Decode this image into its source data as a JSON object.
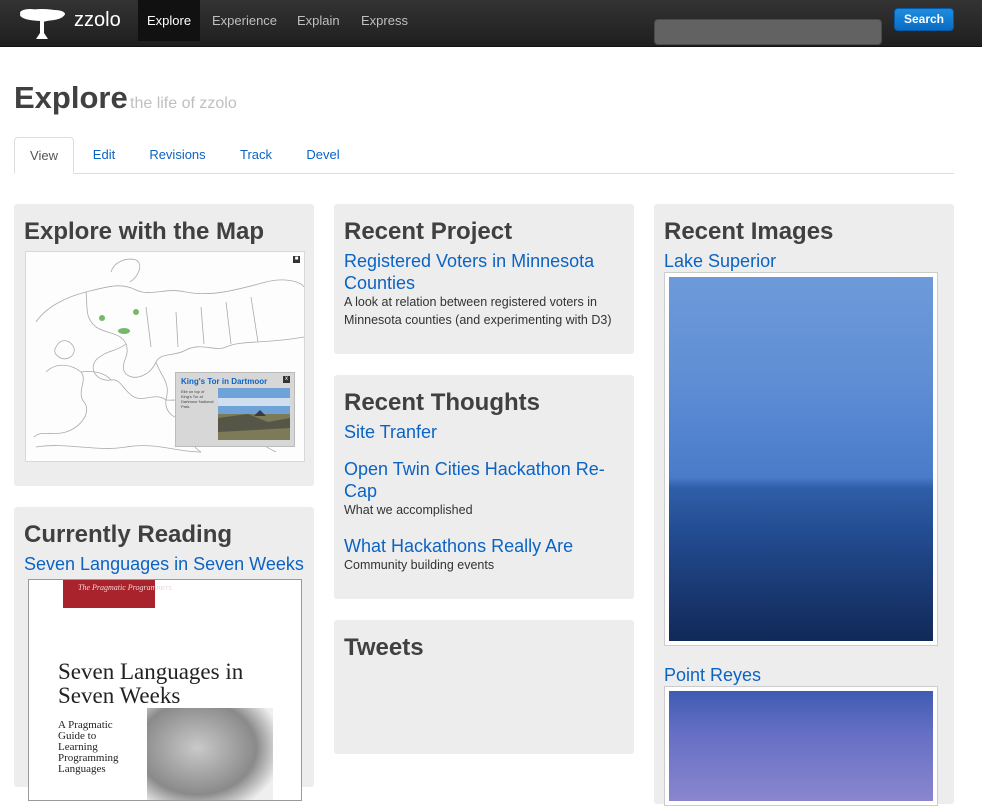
{
  "brand": {
    "name": "zzolo"
  },
  "nav": [
    {
      "label": "Explore",
      "active": true
    },
    {
      "label": "Experience"
    },
    {
      "label": "Explain"
    },
    {
      "label": "Express"
    }
  ],
  "search": {
    "button_label": "Search",
    "value": ""
  },
  "page": {
    "title": "Explore",
    "subtitle": "the life of zzolo"
  },
  "tabs": [
    {
      "label": "View",
      "active": true
    },
    {
      "label": "Edit"
    },
    {
      "label": "Revisions"
    },
    {
      "label": "Track"
    },
    {
      "label": "Devel"
    }
  ],
  "map_panel": {
    "title": "Explore with the Map",
    "popup_title": "King's Tor in Dartmoor",
    "popup_text": "Elle on top of King's Tor at Dartmoor National Park."
  },
  "reading_panel": {
    "title": "Currently Reading",
    "book_link": "Seven Languages in Seven Weeks",
    "cover_publisher": "The Pragmatic Programmers",
    "cover_title": "Seven Languages in Seven Weeks",
    "cover_subtitle": "A Pragmatic Guide to Learning Programming Languages"
  },
  "project_panel": {
    "title": "Recent Project",
    "link": "Registered Voters in Minnesota Counties",
    "description": "A look at relation between registered voters in Minnesota counties (and experimenting with D3)"
  },
  "thoughts_panel": {
    "title": "Recent Thoughts",
    "items": [
      {
        "link": "Site Tranfer",
        "description": ""
      },
      {
        "link": "Open Twin Cities Hackathon Re-Cap",
        "description": "What we accomplished"
      },
      {
        "link": "What Hackathons Really Are",
        "description": "Community building events"
      }
    ]
  },
  "tweets_panel": {
    "title": "Tweets"
  },
  "images_panel": {
    "title": "Recent Images",
    "images": [
      {
        "caption": "Lake Superior"
      },
      {
        "caption": "Point Reyes"
      }
    ]
  }
}
